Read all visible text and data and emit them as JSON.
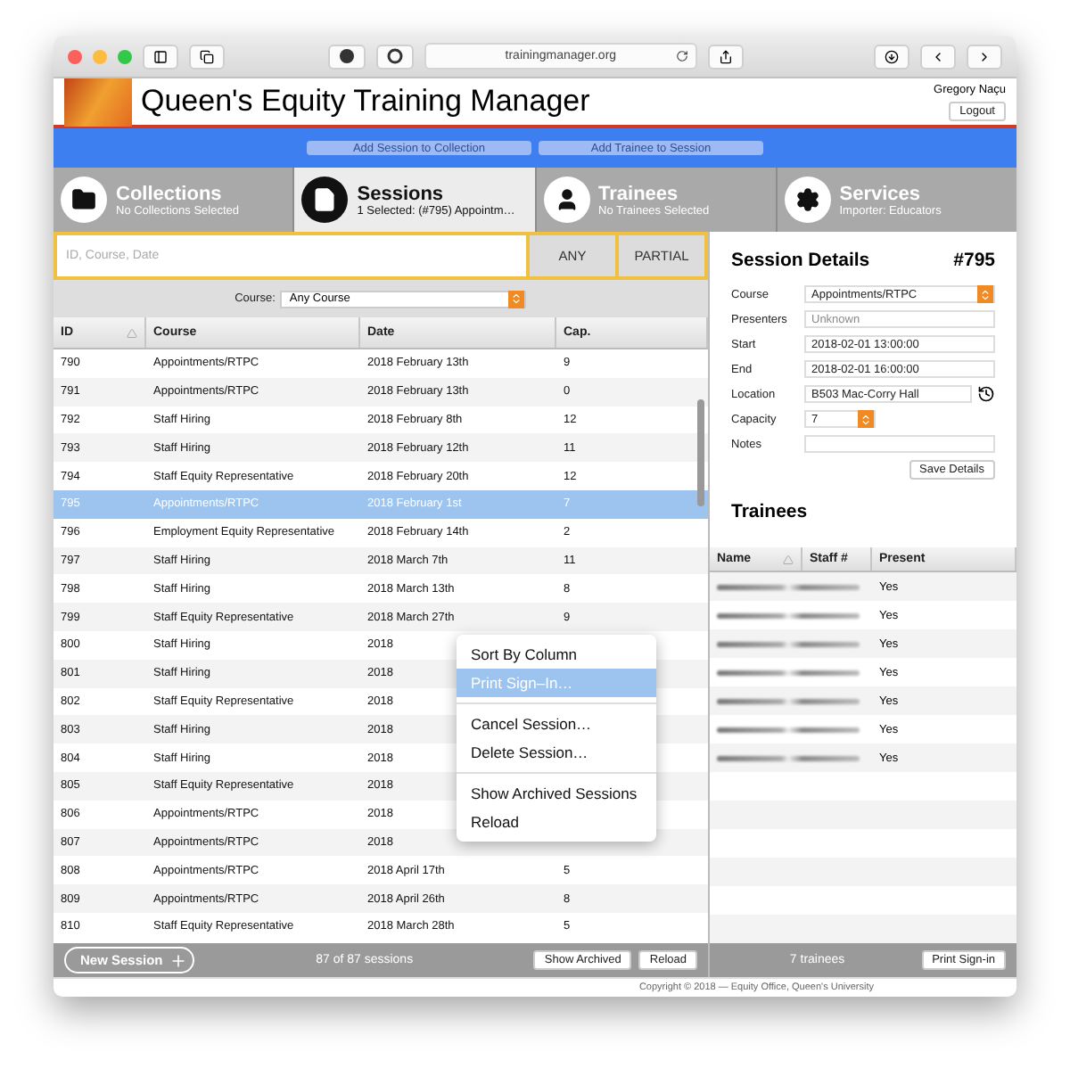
{
  "browser": {
    "url": "trainingmanager.org"
  },
  "header": {
    "title": "Queen's Equity Training Manager",
    "user": "Gregory Naçu",
    "logout": "Logout"
  },
  "actions": [
    {
      "label": "Add Session to Collection",
      "disabled": true
    },
    {
      "label": "Add Trainee to Session",
      "disabled": true
    }
  ],
  "tabs": [
    {
      "kind": "collections",
      "title": "Collections",
      "subtitle": "No Collections Selected",
      "selected": false
    },
    {
      "kind": "sessions",
      "title": "Sessions",
      "subtitle": "1 Selected: (#795) Appointm…",
      "selected": true
    },
    {
      "kind": "trainees",
      "title": "Trainees",
      "subtitle": "No Trainees Selected",
      "selected": false
    },
    {
      "kind": "services",
      "title": "Services",
      "subtitle": "Importer: Educators",
      "selected": false
    }
  ],
  "search": {
    "placeholder": "ID, Course, Date",
    "buttons": [
      "ANY",
      "PARTIAL"
    ]
  },
  "course_filter": {
    "label": "Course:",
    "value": "Any Course"
  },
  "table": {
    "columns": [
      "ID",
      "Course",
      "Date",
      "Cap."
    ],
    "rows": [
      {
        "id": "790",
        "course": "Appointments/RTPC",
        "date": "2018 February 13th",
        "cap": "9",
        "selected": false
      },
      {
        "id": "791",
        "course": "Appointments/RTPC",
        "date": "2018 February 13th",
        "cap": "0",
        "selected": false
      },
      {
        "id": "792",
        "course": "Staff Hiring",
        "date": "2018 February 8th",
        "cap": "12",
        "selected": false
      },
      {
        "id": "793",
        "course": "Staff Hiring",
        "date": "2018 February 12th",
        "cap": "11",
        "selected": false
      },
      {
        "id": "794",
        "course": "Staff Equity Representative",
        "date": "2018 February 20th",
        "cap": "12",
        "selected": false
      },
      {
        "id": "795",
        "course": "Appointments/RTPC",
        "date": "2018 February 1st",
        "cap": "7",
        "selected": true
      },
      {
        "id": "796",
        "course": "Employment Equity Representative",
        "date": "2018 February 14th",
        "cap": "2",
        "selected": false
      },
      {
        "id": "797",
        "course": "Staff Hiring",
        "date": "2018 March 7th",
        "cap": "11",
        "selected": false
      },
      {
        "id": "798",
        "course": "Staff Hiring",
        "date": "2018 March 13th",
        "cap": "8",
        "selected": false
      },
      {
        "id": "799",
        "course": "Staff Equity Representative",
        "date": "2018 March 27th",
        "cap": "9",
        "selected": false
      },
      {
        "id": "800",
        "course": "Staff Hiring",
        "date": "2018",
        "selected": false
      },
      {
        "id": "801",
        "course": "Staff Hiring",
        "date": "2018",
        "selected": false
      },
      {
        "id": "802",
        "course": "Staff Equity Representative",
        "date": "2018",
        "selected": false
      },
      {
        "id": "803",
        "course": "Staff Hiring",
        "date": "2018",
        "selected": false
      },
      {
        "id": "804",
        "course": "Staff Hiring",
        "date": "2018",
        "selected": false
      },
      {
        "id": "805",
        "course": "Staff Equity Representative",
        "date": "2018",
        "selected": false
      },
      {
        "id": "806",
        "course": "Appointments/RTPC",
        "date": "2018",
        "selected": false
      },
      {
        "id": "807",
        "course": "Appointments/RTPC",
        "date": "2018",
        "selected": false
      },
      {
        "id": "808",
        "course": "Appointments/RTPC",
        "date": "2018 April 17th",
        "cap": "5",
        "selected": false
      },
      {
        "id": "809",
        "course": "Appointments/RTPC",
        "date": "2018 April 26th",
        "cap": "8",
        "selected": false
      },
      {
        "id": "810",
        "course": "Staff Equity Representative",
        "date": "2018 March 28th",
        "cap": "5",
        "selected": false
      }
    ]
  },
  "context_menu": [
    {
      "kind": "item",
      "label": "Sort By Column",
      "highlighted": false
    },
    {
      "kind": "item",
      "label": "Print Sign–In…",
      "highlighted": true
    },
    {
      "kind": "separator"
    },
    {
      "kind": "item",
      "label": "Cancel Session…",
      "highlighted": false
    },
    {
      "kind": "item",
      "label": "Delete Session…",
      "highlighted": false
    },
    {
      "kind": "separator"
    },
    {
      "kind": "item",
      "label": "Show Archived Sessions",
      "highlighted": false
    },
    {
      "kind": "item",
      "label": "Reload",
      "highlighted": false
    }
  ],
  "footer": {
    "new_session": "New Session",
    "count": "87 of 87 sessions",
    "buttons": [
      "Show Archived",
      "Reload"
    ]
  },
  "copyright": "Copyright © 2018 — Equity Office, Queen's University",
  "details": {
    "title": "Session Details",
    "number": "#795",
    "fields": [
      {
        "kind": "select",
        "label": "Course",
        "value": "Appointments/RTPC"
      },
      {
        "kind": "placeholder",
        "label": "Presenters",
        "placeholder": "Unknown"
      },
      {
        "kind": "text",
        "label": "Start",
        "value": "2018-02-01 13:00:00"
      },
      {
        "kind": "text",
        "label": "End",
        "value": "2018-02-01 16:00:00"
      },
      {
        "kind": "history",
        "label": "Location",
        "value": "B503 Mac-Corry Hall"
      },
      {
        "kind": "stepper",
        "label": "Capacity",
        "value": "7"
      },
      {
        "kind": "text",
        "label": "Notes"
      }
    ],
    "save": "Save Details"
  },
  "trainees": {
    "title": "Trainees",
    "columns": [
      "Name",
      "Staff #",
      "Present"
    ],
    "rows": [
      {
        "present": "Yes"
      },
      {
        "present": "Yes"
      },
      {
        "present": "Yes"
      },
      {
        "present": "Yes"
      },
      {
        "present": "Yes"
      },
      {
        "present": "Yes"
      },
      {
        "present": "Yes"
      }
    ],
    "count": "7 trainees",
    "print": "Print Sign-in"
  }
}
